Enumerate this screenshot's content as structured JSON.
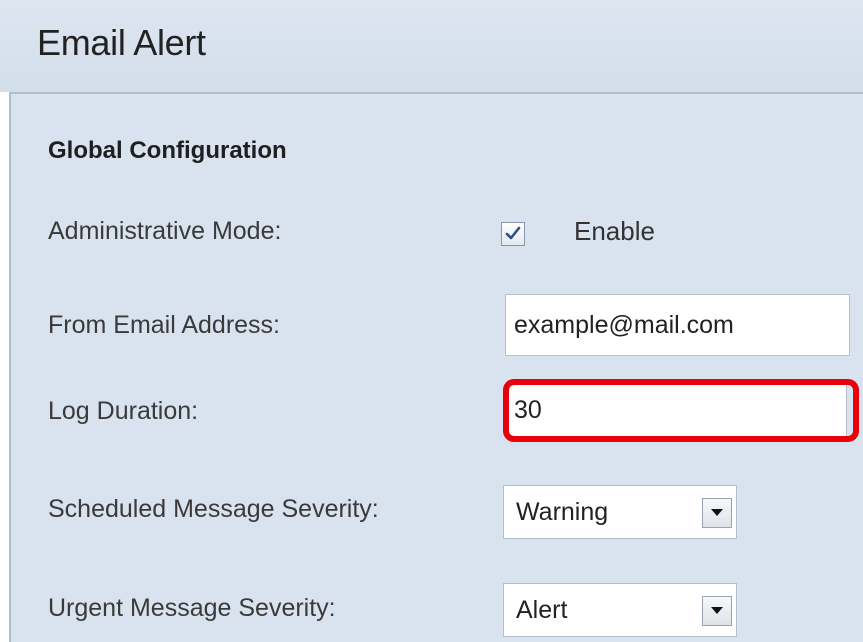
{
  "page": {
    "title": "Email Alert"
  },
  "global_config": {
    "section_title": "Global Configuration",
    "admin_mode": {
      "label": "Administrative Mode:",
      "checkbox_label": "Enable",
      "checked": true
    },
    "from_email": {
      "label": "From Email Address:",
      "value": "example@mail.com"
    },
    "log_duration": {
      "label": "Log Duration:",
      "value": "30"
    },
    "scheduled_severity": {
      "label": "Scheduled Message Severity:",
      "value": "Warning"
    },
    "urgent_severity": {
      "label": "Urgent Message Severity:",
      "value": "Alert"
    }
  },
  "colors": {
    "highlight": "#e8000b",
    "panel_background": "#d8e3ef",
    "header_background": "#dde6f1"
  },
  "icons": {
    "checkbox_mark": "checkmark-icon",
    "dropdown_arrow": "chevron-down-icon"
  }
}
